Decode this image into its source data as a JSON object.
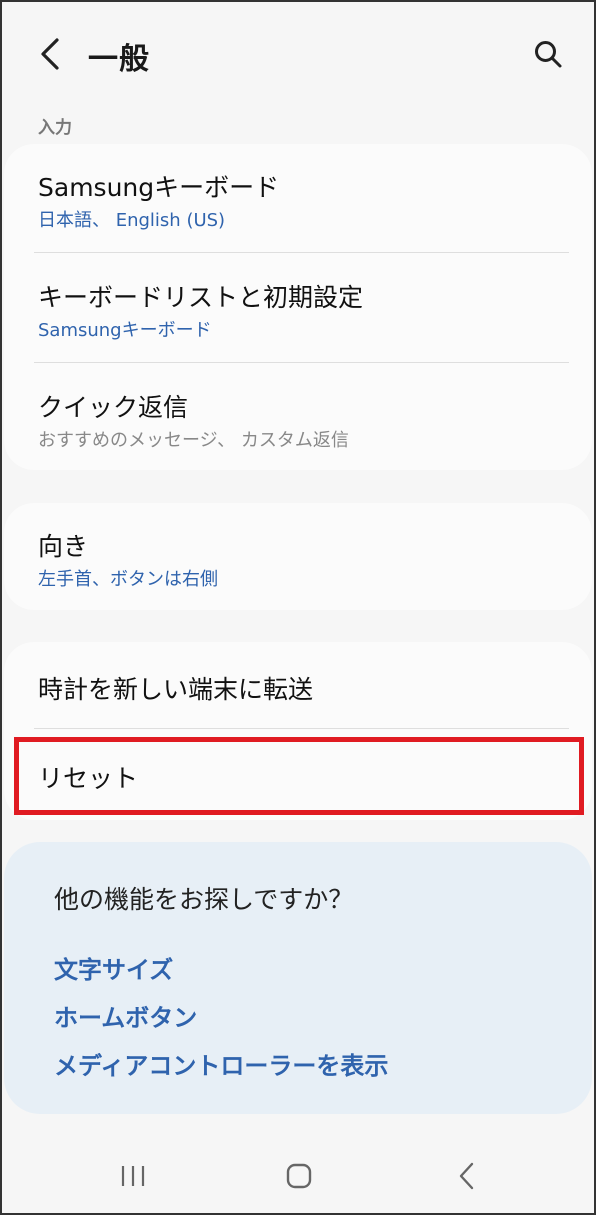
{
  "header": {
    "title": "一般",
    "back_icon": "chevron-left-icon",
    "search_icon": "search-icon"
  },
  "section": {
    "input_label": "入力"
  },
  "input_items": [
    {
      "title": "Samsungキーボード",
      "subtitle": "日本語、 English (US)"
    },
    {
      "title": "キーボードリストと初期設定",
      "subtitle": "Samsungキーボード"
    },
    {
      "title": "クイック返信",
      "subtitle": "おすすめのメッセージ、 カスタム返信"
    }
  ],
  "orientation": {
    "title": "向き",
    "subtitle": "左手首、ボタンは右側"
  },
  "transfer": {
    "title": "時計を新しい端末に転送"
  },
  "reset": {
    "title": "リセット"
  },
  "suggestions": {
    "title": "他の機能をお探しですか？",
    "links": [
      "文字サイズ",
      "ホームボタン",
      "メディアコントローラーを表示"
    ]
  },
  "navbar": {
    "recents_icon": "recents-icon",
    "home_icon": "home-icon",
    "back_icon": "back-icon"
  },
  "colors": {
    "accent": "#2f63ad",
    "highlight": "#e01b22",
    "suggest_bg": "#e7eff6"
  }
}
